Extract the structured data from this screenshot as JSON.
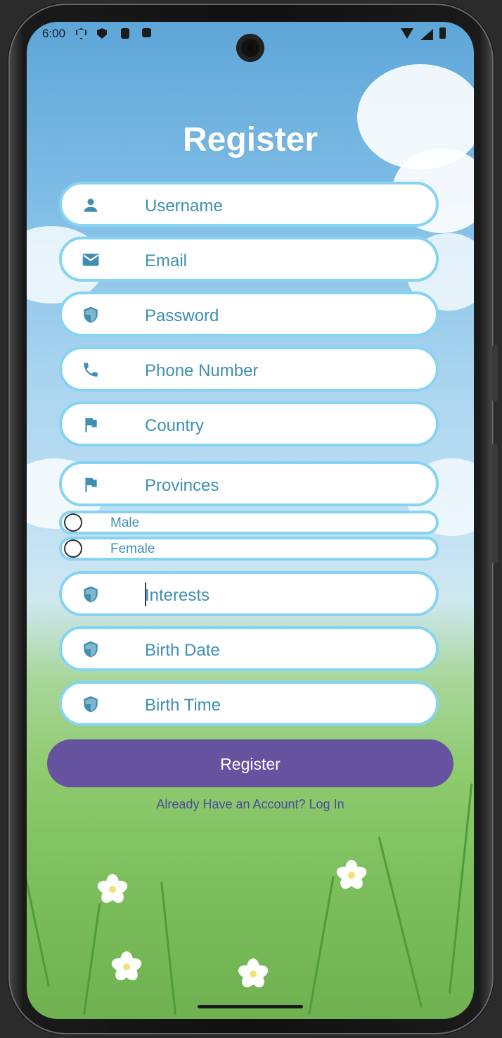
{
  "status_bar": {
    "time": "6:00"
  },
  "screen": {
    "title": "Register",
    "fields": [
      {
        "icon": "person-icon",
        "placeholder": "Username"
      },
      {
        "icon": "email-icon",
        "placeholder": "Email"
      },
      {
        "icon": "shield-icon",
        "placeholder": "Password"
      },
      {
        "icon": "phone-icon",
        "placeholder": "Phone Number"
      },
      {
        "icon": "flag-icon",
        "placeholder": "Country"
      },
      {
        "icon": "flag-icon",
        "placeholder": "Provinces"
      }
    ],
    "gender_options": [
      {
        "label": "Male",
        "selected": false
      },
      {
        "label": "Female",
        "selected": false
      }
    ],
    "fields_after": [
      {
        "icon": "shield-icon",
        "placeholder": "Interests",
        "focused": true
      },
      {
        "icon": "shield-icon",
        "placeholder": "Birth Date"
      },
      {
        "icon": "shield-icon",
        "placeholder": "Birth Time"
      }
    ],
    "register_button": "Register",
    "login_link": "Already Have an Account? Log In"
  },
  "colors": {
    "field_border": "#87d3f2",
    "field_text": "#3f8fb3",
    "button": "#6553a0",
    "link": "#4d4a9a"
  }
}
